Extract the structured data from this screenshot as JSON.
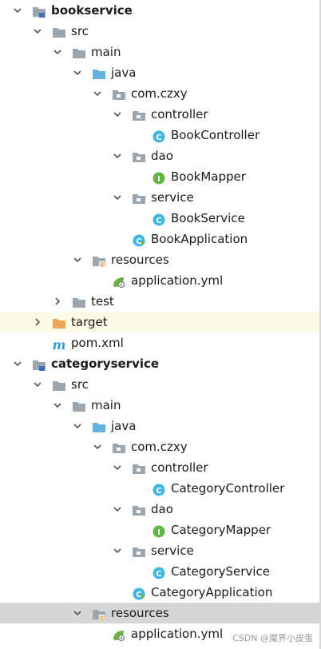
{
  "tree": [
    {
      "label": "bookservice",
      "icon": "module-folder-icon",
      "expanded": true,
      "bold": true
    },
    {
      "label": "src",
      "icon": "folder-icon",
      "expanded": true
    },
    {
      "label": "main",
      "icon": "folder-icon",
      "expanded": true
    },
    {
      "label": "java",
      "icon": "source-folder-icon",
      "expanded": true
    },
    {
      "label": "com.czxy",
      "icon": "package-icon",
      "expanded": true
    },
    {
      "label": "controller",
      "icon": "package-icon",
      "expanded": true
    },
    {
      "label": "BookController",
      "icon": "class-icon"
    },
    {
      "label": "dao",
      "icon": "package-icon",
      "expanded": true
    },
    {
      "label": "BookMapper",
      "icon": "interface-icon"
    },
    {
      "label": "service",
      "icon": "package-icon",
      "expanded": true
    },
    {
      "label": "BookService",
      "icon": "class-icon"
    },
    {
      "label": "BookApplication",
      "icon": "spring-boot-class-icon"
    },
    {
      "label": "resources",
      "icon": "resources-folder-icon",
      "expanded": true
    },
    {
      "label": "application.yml",
      "icon": "spring-config-icon"
    },
    {
      "label": "test",
      "icon": "folder-icon",
      "expanded": false
    },
    {
      "label": "target",
      "icon": "excluded-folder-icon",
      "expanded": false
    },
    {
      "label": "pom.xml",
      "icon": "maven-icon"
    },
    {
      "label": "categoryservice",
      "icon": "module-folder-icon",
      "expanded": true,
      "bold": true
    },
    {
      "label": "src",
      "icon": "folder-icon",
      "expanded": true
    },
    {
      "label": "main",
      "icon": "folder-icon",
      "expanded": true
    },
    {
      "label": "java",
      "icon": "source-folder-icon",
      "expanded": true
    },
    {
      "label": "com.czxy",
      "icon": "package-icon",
      "expanded": true
    },
    {
      "label": "controller",
      "icon": "package-icon",
      "expanded": true
    },
    {
      "label": "CategoryController",
      "icon": "class-icon"
    },
    {
      "label": "dao",
      "icon": "package-icon",
      "expanded": true
    },
    {
      "label": "CategoryMapper",
      "icon": "interface-icon"
    },
    {
      "label": "service",
      "icon": "package-icon",
      "expanded": true
    },
    {
      "label": "CategoryService",
      "icon": "class-icon"
    },
    {
      "label": "CategoryApplication",
      "icon": "spring-boot-class-icon"
    },
    {
      "label": "resources",
      "icon": "resources-folder-icon",
      "expanded": true,
      "selected": true
    },
    {
      "label": "application.yml",
      "icon": "spring-config-icon"
    }
  ],
  "watermark": "CSDN @魔界小皮蛋",
  "colors": {
    "folder": "#9aa7b0",
    "source_folder": "#62b3e0",
    "excluded_folder": "#f1a25d",
    "class": "#40b6e0",
    "interface": "#62b543",
    "spring": "#6db33f",
    "maven": "#2d9cdb",
    "selection": "#d6d6d6",
    "hover": "#fdfbe6"
  }
}
